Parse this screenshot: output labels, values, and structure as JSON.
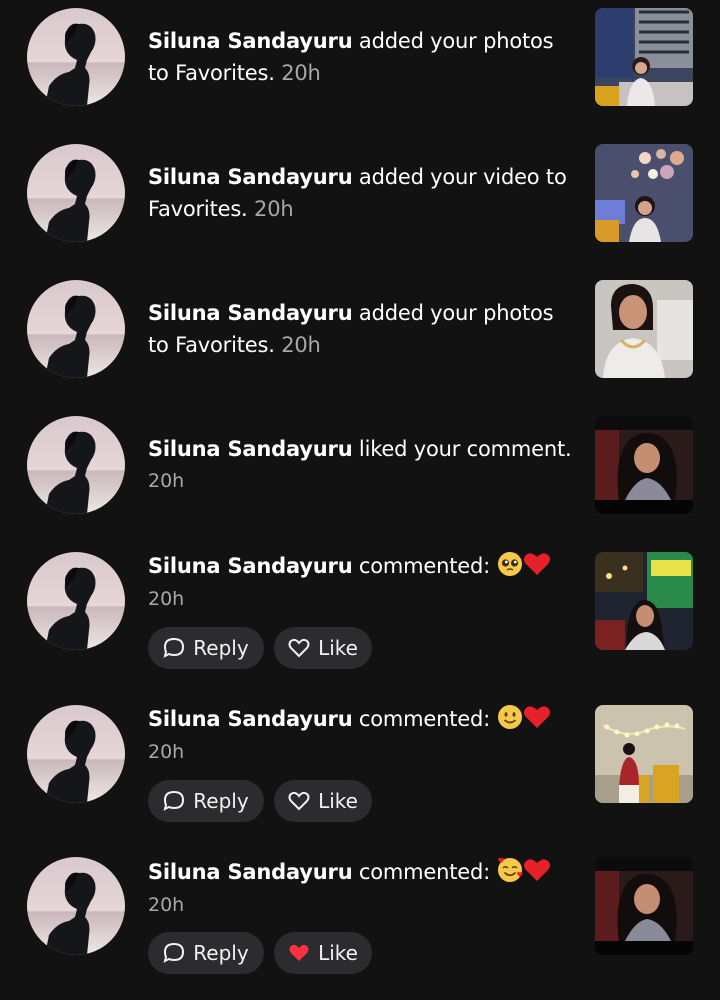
{
  "notifications": [
    {
      "name": "Siluna Sandayuru",
      "action": " added your photos to Favorites.",
      "time": "20h",
      "thumb": "woman-sofa-photo"
    },
    {
      "name": "Siluna Sandayuru",
      "action": " added your video to Favorites.",
      "time": "20h",
      "thumb": "party-lights-video"
    },
    {
      "name": "Siluna Sandayuru",
      "action": " added your photos to Favorites.",
      "time": "20h",
      "thumb": "woman-white-dress-photo"
    },
    {
      "name": "Siluna Sandayuru",
      "action": " liked your comment.",
      "time": "20h",
      "thumb": "woman-curly-hair-photo"
    },
    {
      "name": "Siluna Sandayuru",
      "action": " commented: ",
      "emoji": "🥺❤️",
      "time": "20h",
      "thumb": "cafe-neon-photo",
      "reply_label": "Reply",
      "like_label": "Like",
      "liked": false
    },
    {
      "name": "Siluna Sandayuru",
      "action": " commented: ",
      "emoji": "🙂❤️",
      "time": "20h",
      "thumb": "fairy-lights-photo",
      "reply_label": "Reply",
      "like_label": "Like",
      "liked": false
    },
    {
      "name": "Siluna Sandayuru",
      "action": " commented: ",
      "emoji": "🥰❤️",
      "time": "20h",
      "thumb": "woman-curly-hair-photo-2",
      "reply_label": "Reply",
      "like_label": "Like",
      "liked": true
    }
  ],
  "colors": {
    "background": "#121212",
    "pill": "#2c2c2e",
    "timestamp": "#a8a8a8",
    "liked_heart": "#ff3040"
  }
}
